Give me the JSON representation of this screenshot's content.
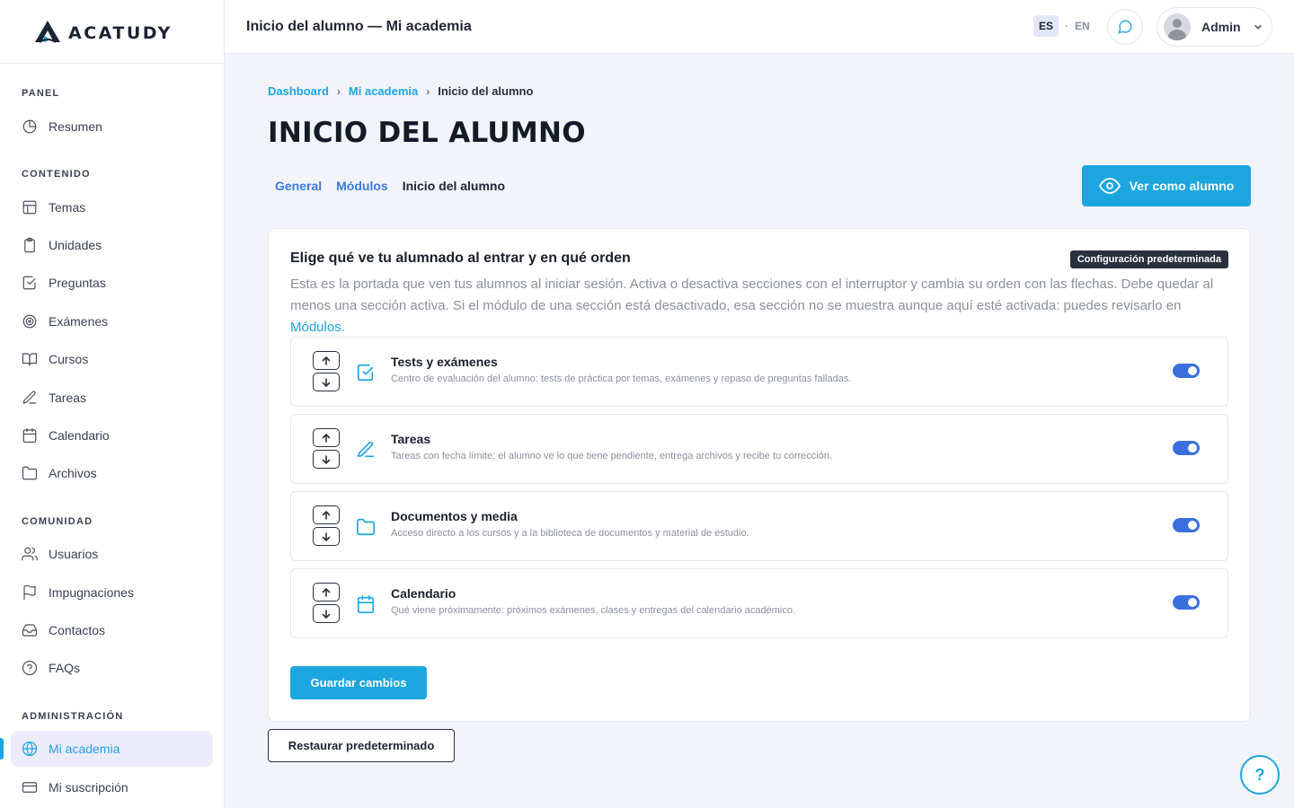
{
  "brand": {
    "name": "ACATUDY",
    "accent": "#1ba6e0"
  },
  "sidebar": {
    "sections": [
      {
        "label": "PANEL",
        "items": [
          {
            "label": "Resumen",
            "icon": "pie-chart-icon"
          }
        ]
      },
      {
        "label": "CONTENIDO",
        "items": [
          {
            "label": "Temas",
            "icon": "layout-icon"
          },
          {
            "label": "Unidades",
            "icon": "clipboard-icon"
          },
          {
            "label": "Preguntas",
            "icon": "check-square-icon"
          },
          {
            "label": "Exámenes",
            "icon": "target-icon"
          },
          {
            "label": "Cursos",
            "icon": "book-open-icon"
          },
          {
            "label": "Tareas",
            "icon": "pen-icon"
          },
          {
            "label": "Calendario",
            "icon": "calendar-icon"
          },
          {
            "label": "Archivos",
            "icon": "folder-icon"
          }
        ]
      },
      {
        "label": "COMUNIDAD",
        "items": [
          {
            "label": "Usuarios",
            "icon": "users-icon"
          },
          {
            "label": "Impugnaciones",
            "icon": "flag-icon"
          },
          {
            "label": "Contactos",
            "icon": "inbox-icon"
          },
          {
            "label": "FAQs",
            "icon": "help-circle-icon"
          }
        ]
      },
      {
        "label": "ADMINISTRACIÓN",
        "items": [
          {
            "label": "Mi academia",
            "icon": "globe-icon",
            "active": true
          },
          {
            "label": "Mi suscripción",
            "icon": "credit-card-icon"
          }
        ]
      }
    ]
  },
  "topbar": {
    "title": "Inicio del alumno — Mi academia",
    "lang_es": "ES",
    "lang_sep": "·",
    "lang_en": "EN",
    "user_name": "Admin"
  },
  "breadcrumb": {
    "items": [
      "Dashboard",
      "Mi academia"
    ],
    "current": "Inicio del alumno"
  },
  "page_title": "INICIO DEL ALUMNO",
  "tabs": [
    {
      "label": "General"
    },
    {
      "label": "Módulos"
    },
    {
      "label": "Inicio del alumno",
      "current": true
    }
  ],
  "view_as_student": "Ver como alumno",
  "card": {
    "title": "Elige qué ve tu alumnado al entrar y en qué orden",
    "badge": "Configuración predeterminada",
    "description": "Esta es la portada que ven tus alumnos al iniciar sesión. Activa o desactiva secciones con el interruptor y cambia su orden con las flechas. Debe quedar al menos una sección activa. Si el módulo de una sección está desactivado, esa sección no se muestra aunque aquí esté activada: puedes revisarlo en",
    "description_link": "Módulos",
    "description_end": ".",
    "sections": [
      {
        "title": "Tests y exámenes",
        "desc": "Centro de evaluación del alumno: tests de práctica por temas, exámenes y repaso de preguntas falladas.",
        "icon": "check-square-icon",
        "enabled": true
      },
      {
        "title": "Tareas",
        "desc": "Tareas con fecha límite: el alumno ve lo que tiene pendiente, entrega archivos y recibe tu corrección.",
        "icon": "pen-icon",
        "enabled": true
      },
      {
        "title": "Documentos y media",
        "desc": "Acceso directo a los cursos y a la biblioteca de documentos y material de estudio.",
        "icon": "folder-icon",
        "enabled": true
      },
      {
        "title": "Calendario",
        "desc": "Qué viene próximamente: próximos exámenes, clases y entregas del calendario académico.",
        "icon": "calendar-icon",
        "enabled": true
      }
    ],
    "save_label": "Guardar cambios"
  },
  "reset_label": "Restaurar predeterminado",
  "help_label": "?"
}
